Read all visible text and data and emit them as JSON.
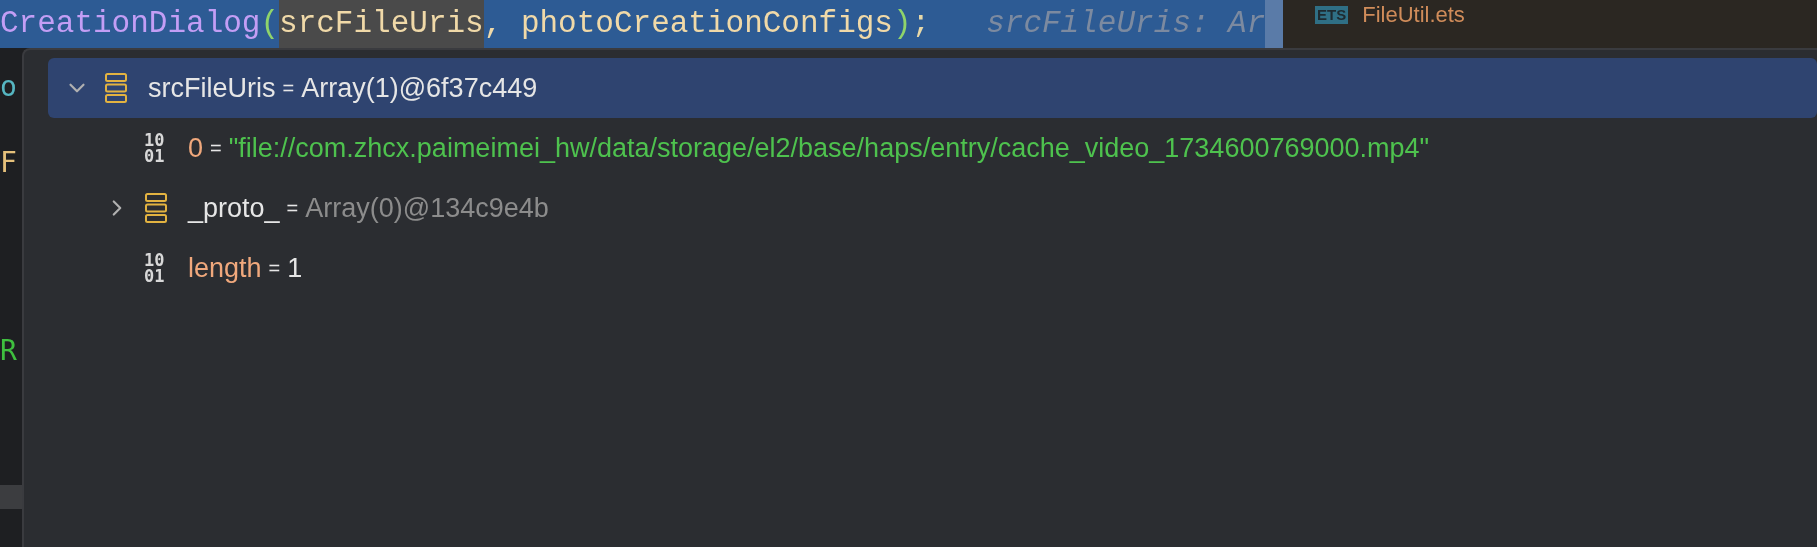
{
  "editor": {
    "code_tokens": [
      {
        "text": "CreationDialog",
        "kind": "method",
        "highlighted": false
      },
      {
        "text": "(",
        "kind": "paren",
        "highlighted": false
      },
      {
        "text": "srcFileUris",
        "kind": "variable",
        "highlighted": true
      },
      {
        "text": ", photoCreationConfigs",
        "kind": "variable",
        "highlighted": false
      },
      {
        "text": ")",
        "kind": "paren",
        "highlighted": false
      },
      {
        "text": ";",
        "kind": "punct",
        "highlighted": false
      }
    ],
    "inlay_hint": "srcFileUris: Ar",
    "side_fragments": [
      {
        "text": "o",
        "color": "#56b6c2"
      },
      {
        "text": "F",
        "color": "#e5c07b"
      },
      {
        "text": "R",
        "color": "#3fbf3f"
      }
    ]
  },
  "file_tab": {
    "badge": "ETS",
    "label": "FileUtil.ets"
  },
  "variables": {
    "tree": [
      {
        "kind": "object",
        "name": "srcFileUris",
        "separator": "=",
        "value": "Array(1)@6f37c449",
        "color": "#e6e6e6",
        "selected": true,
        "expanded": true,
        "children": [
          {
            "kind": "primitive",
            "icon_lines": [
              "10",
              "01"
            ],
            "name": "0",
            "separator": "=",
            "value": "\"file://com.zhcx.paimeimei_hw/data/storage/el2/base/haps/entry/cache_video_1734600769000.mp4\"",
            "color": "#4ec24e",
            "selected": false
          },
          {
            "kind": "object",
            "name": "_proto_",
            "separator": "=",
            "value": "Array(0)@134c9e4b",
            "color": "#8c8c8c",
            "selected": false,
            "expanded": false
          },
          {
            "kind": "primitive",
            "icon_lines": [
              "10",
              "01"
            ],
            "name": "length",
            "separator": "=",
            "value": "1",
            "color": "#e6e6e6",
            "selected": false
          }
        ]
      }
    ]
  }
}
